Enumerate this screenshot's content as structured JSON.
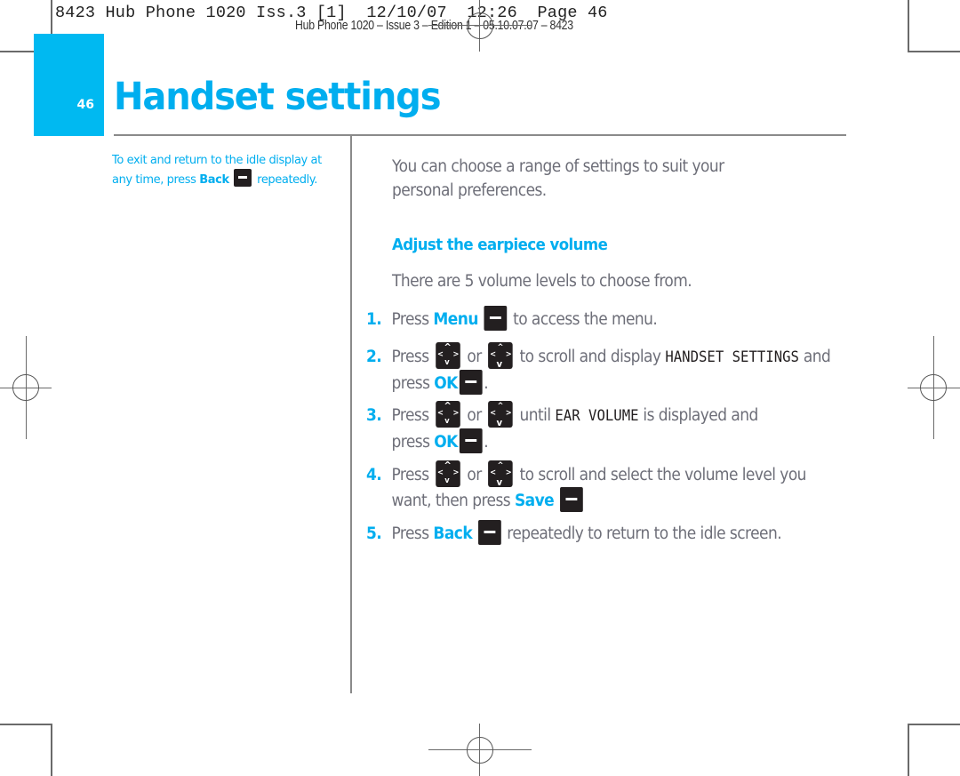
{
  "slug": {
    "line1": "8423 Hub Phone 1020 Iss.3 [1]  12/10/07  12:26  Page 46",
    "line2": "Hub Phone 1020 – Issue 3 – Edition 1 – 05.10.07.07 – 8423"
  },
  "page": {
    "number": "46",
    "title": "Handset settings",
    "accent_color": "#00aeef",
    "tab_color": "#00b9f1"
  },
  "sidebar_note": {
    "text_before": "To exit and return to the idle display at any time, press ",
    "key_label": "Back",
    "text_after": " repeatedly.",
    "key_icon": "soft-key-icon"
  },
  "main": {
    "intro_line1": "You can choose a range of settings to suit your",
    "intro_line2": "personal preferences.",
    "section_heading": "Adjust the earpiece volume",
    "levels_text": "There are 5 volume levels to choose from.",
    "steps": [
      {
        "number": "1.",
        "parts": [
          "Press ",
          "Menu",
          " to access the menu."
        ]
      },
      {
        "number": "2.",
        "parts": [
          "Press ",
          " or ",
          " to scroll and display ",
          "HANDSET SETTINGS",
          " and"
        ],
        "cont": [
          "press ",
          "OK",
          "."
        ]
      },
      {
        "number": "3.",
        "parts": [
          "Press ",
          " or ",
          " until ",
          "EAR VOLUME",
          " is displayed and"
        ],
        "cont": [
          "press ",
          "OK",
          "."
        ]
      },
      {
        "number": "4.",
        "parts": [
          "Press ",
          " or ",
          " to scroll and select the volume level you"
        ],
        "cont": [
          "want, then press ",
          "Save"
        ]
      },
      {
        "number": "5.",
        "parts": [
          "Press ",
          "Back",
          " repeatedly to return to the idle screen."
        ]
      }
    ],
    "icons": {
      "soft_key": "soft-key-icon",
      "nav_up": "nav-key-up-icon",
      "nav_down": "nav-key-down-icon"
    }
  }
}
